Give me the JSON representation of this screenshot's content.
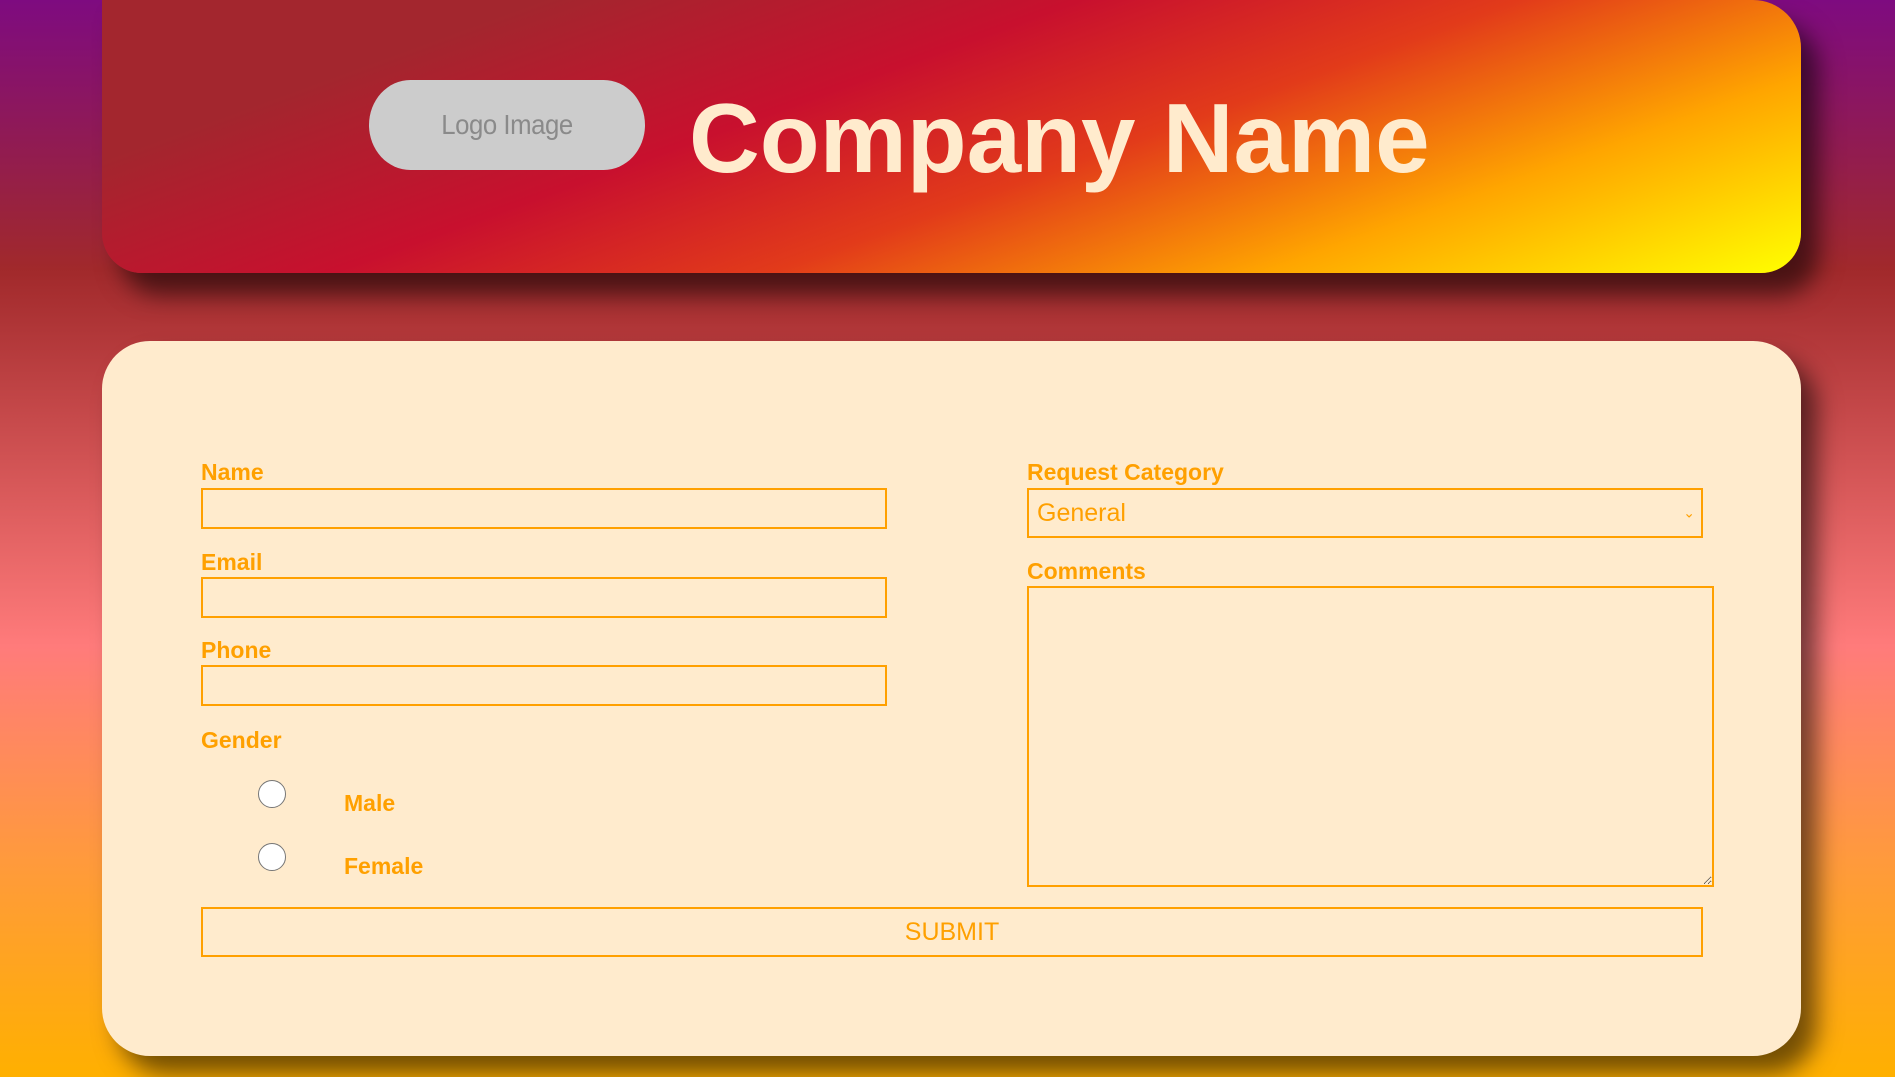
{
  "header": {
    "logo_text": "Logo Image",
    "company_name": "Company Name"
  },
  "form": {
    "name_label": "Name",
    "name_value": "",
    "email_label": "Email",
    "email_value": "",
    "phone_label": "Phone",
    "phone_value": "",
    "gender_label": "Gender",
    "gender_options": [
      "Male",
      "Female"
    ],
    "request_category_label": "Request Category",
    "request_category_selected": "General",
    "comments_label": "Comments",
    "comments_value": "",
    "submit_label": "SUBMIT"
  },
  "colors": {
    "accent": "#ffa000",
    "panel_bg": "#ffebcd",
    "company_name": "#ffebcd",
    "logo_bg": "#cccccc"
  }
}
